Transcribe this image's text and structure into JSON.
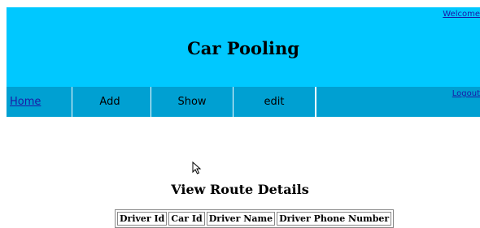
{
  "header": {
    "welcome": "Welcome",
    "title": "Car Pooling"
  },
  "nav": {
    "items": [
      {
        "label": "Home"
      },
      {
        "label": "Add"
      },
      {
        "label": "Show"
      },
      {
        "label": "edit"
      },
      {
        "label": ""
      }
    ],
    "logout": "Logout"
  },
  "main": {
    "title": "View Route Details",
    "table": {
      "headers": [
        "Driver Id",
        "Car Id",
        "Driver Name",
        "Driver Phone Number"
      ]
    }
  },
  "icons": {
    "cursor": "mouse-pointer-icon"
  }
}
